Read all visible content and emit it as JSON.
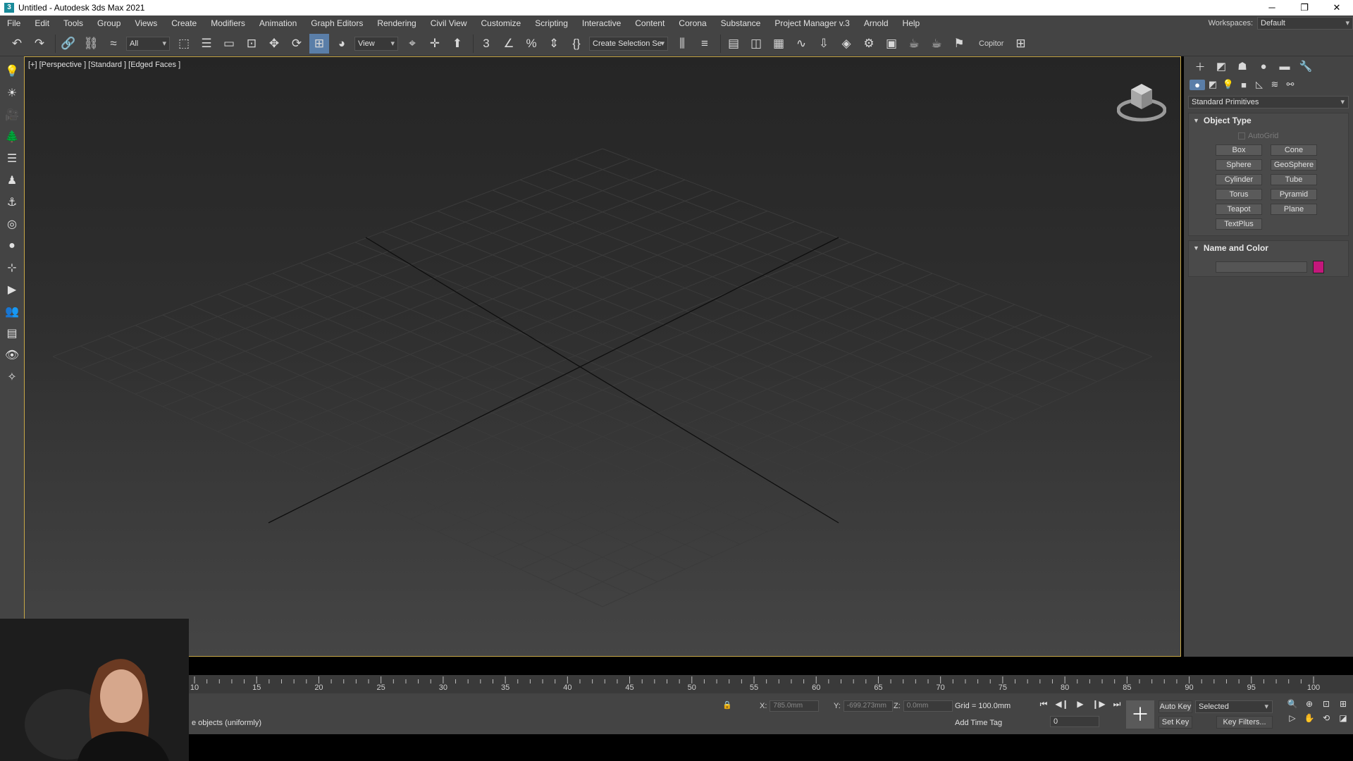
{
  "window": {
    "title": "Untitled - Autodesk 3ds Max 2021",
    "controls": [
      "─",
      "❐",
      "✕"
    ]
  },
  "menu": {
    "items": [
      "File",
      "Edit",
      "Tools",
      "Group",
      "Views",
      "Create",
      "Modifiers",
      "Animation",
      "Graph Editors",
      "Rendering",
      "Civil View",
      "Customize",
      "Scripting",
      "Interactive",
      "Content",
      "Corona",
      "Substance",
      "Project Manager v.3",
      "Arnold",
      "Help"
    ],
    "workspaces_label": "Workspaces:",
    "workspace_value": "Default"
  },
  "toolbar": {
    "filter_value": "All",
    "view_value": "View",
    "selection_set_value": "Create Selection Se",
    "copitor_label": "Copitor"
  },
  "viewport": {
    "label": "[+] [Perspective ] [Standard ] [Edged Faces ]"
  },
  "command_panel": {
    "category_dropdown": "Standard Primitives",
    "object_type": {
      "title": "Object Type",
      "autogrid_label": "AutoGrid",
      "buttons": [
        "Box",
        "Cone",
        "Sphere",
        "GeoSphere",
        "Cylinder",
        "Tube",
        "Torus",
        "Pyramid",
        "Teapot",
        "Plane",
        "TextPlus"
      ]
    },
    "name_and_color": {
      "title": "Name and Color",
      "name_value": "",
      "color": "#c4177b"
    }
  },
  "timeline": {
    "labels": [
      "10",
      "15",
      "20",
      "25",
      "30",
      "35",
      "40",
      "45",
      "50",
      "55",
      "60",
      "65",
      "70",
      "75",
      "80",
      "85",
      "90",
      "95",
      "100"
    ]
  },
  "status": {
    "prompt": "e objects (uniformly)",
    "x_label": "X:",
    "x_value": "785.0mm",
    "y_label": "Y:",
    "y_value": "-699.273mm",
    "z_label": "Z:",
    "z_value": "0.0mm",
    "grid": "Grid = 100.0mm",
    "add_time_tag": "Add Time Tag",
    "frame_value": "0",
    "auto_key": "Auto Key",
    "set_key": "Set Key",
    "selected_value": "Selected",
    "key_filters": "Key Filters..."
  },
  "colors": {
    "accent_blue": "#5a7ea8",
    "viewport_border": "#c7a747"
  }
}
